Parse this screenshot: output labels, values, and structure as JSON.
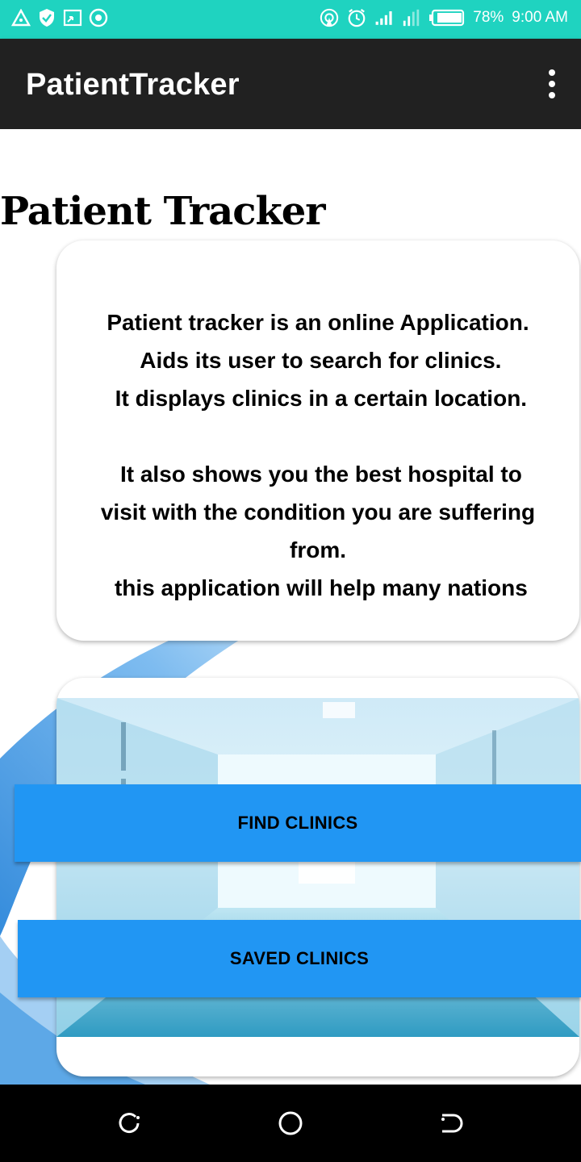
{
  "status_bar": {
    "battery": "78%",
    "time": "9:00 AM",
    "left_icons": [
      "warning-triangle-icon",
      "shield-icon",
      "screencast-icon",
      "target-icon"
    ],
    "right_icons": [
      "hotspot-icon",
      "alarm-icon",
      "signal-icon",
      "data-signal-icon",
      "battery-icon"
    ]
  },
  "app_bar": {
    "title": "PatientTracker",
    "menu_icon": "more-vert-icon"
  },
  "page": {
    "heading": "Patient Tracker",
    "info_lines_1": [
      "Patient tracker is an online Application.",
      " Aids its user to search for clinics.",
      " It displays clinics in a certain location."
    ],
    "info_lines_2": [
      " It also shows you the best hospital to",
      "visit with the condition you are suffering",
      "from.",
      " this application will help many nations"
    ]
  },
  "buttons": {
    "find_clinics": "FIND CLINICS",
    "saved_clinics": "SAVED CLINICS"
  },
  "nav_bar": {
    "icons": [
      "recent-apps-icon",
      "home-icon",
      "back-icon"
    ]
  },
  "colors": {
    "status_bar": "#1fd3c0",
    "app_bar": "#212121",
    "button": "#2196f3",
    "nav_bar": "#000000"
  }
}
